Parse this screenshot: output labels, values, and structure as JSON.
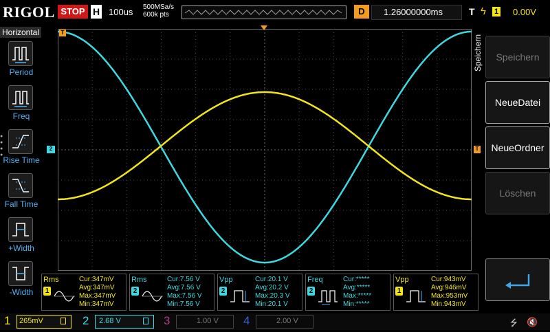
{
  "topbar": {
    "logo": "RIGOL",
    "run_state": "STOP",
    "timebase_label": "H",
    "timebase": "100us",
    "sample_rate": "500MSa/s",
    "memory_depth": "600k pts",
    "delay_label": "D",
    "delay": "1.26000000ms",
    "trigger_label": "T",
    "trigger_source": "1",
    "trigger_level": "0.00V"
  },
  "left_menu": {
    "title": "Horizontal",
    "items": [
      {
        "label": "Period",
        "icon": "period-icon"
      },
      {
        "label": "Freq",
        "icon": "frequency-icon"
      },
      {
        "label": "Rise Time",
        "icon": "rise-time-icon"
      },
      {
        "label": "Fall Time",
        "icon": "fall-time-icon"
      },
      {
        "label": "+Width",
        "icon": "positive-width-icon"
      },
      {
        "label": "-Width",
        "icon": "negative-width-icon"
      }
    ]
  },
  "right_menu": {
    "title": "Speichern",
    "buttons": [
      {
        "label": "Speichern",
        "enabled": false
      },
      {
        "label": "NeueDatei",
        "enabled": true
      },
      {
        "label": "NeueOrdner",
        "enabled": true
      },
      {
        "label": "Löschen",
        "enabled": false
      }
    ],
    "enter_icon": "enter-arrow-icon"
  },
  "screen_markers": {
    "trigger_position": "T",
    "ch2_ground": "2",
    "trigger_level_marker": "T"
  },
  "waveforms": [
    {
      "channel": "2",
      "color": "#3fd8e0",
      "shape": "sine",
      "cycles_visible": 1.0,
      "phase": "peak-at-edges"
    },
    {
      "channel": "1",
      "color": "#f2e61a",
      "shape": "sine",
      "cycles_visible": 1.0,
      "phase": "peak-at-center"
    }
  ],
  "measurements": [
    {
      "name": "Rms",
      "channel": "1",
      "color": "#f2e61a",
      "icon": "rms-sine-icon",
      "cur": "Cur:347mV",
      "avg": "Avg:347mV",
      "max": "Max:347mV",
      "min": "Min:347mV"
    },
    {
      "name": "Rms",
      "channel": "2",
      "color": "#3fd8e0",
      "icon": "rms-sine-icon",
      "cur": "Cur:7.56 V",
      "avg": "Avg:7.56 V",
      "max": "Max:7.56 V",
      "min": "Min:7.56 V"
    },
    {
      "name": "Vpp",
      "channel": "2",
      "color": "#3fd8e0",
      "icon": "vpp-pulse-icon",
      "cur": "Cur:20.1 V",
      "avg": "Avg:20.2 V",
      "max": "Max:20.3 V",
      "min": "Min:20.1 V"
    },
    {
      "name": "Freq",
      "channel": "2",
      "color": "#3fd8e0",
      "icon": "frequency-pulse-icon",
      "cur": "Cur:*****",
      "avg": "Avg:*****",
      "max": "Max:*****",
      "min": "Min:*****"
    },
    {
      "name": "Vpp",
      "channel": "1",
      "color": "#f2e61a",
      "icon": "vpp-pulse-icon",
      "cur": "Cur:943mV",
      "avg": "Avg:946mV",
      "max": "Max:953mV",
      "min": "Min:943mV"
    }
  ],
  "channels": [
    {
      "number": "1",
      "scale": "265mV",
      "color": "#f2e61a",
      "active": true
    },
    {
      "number": "2",
      "scale": "2.68 V",
      "color": "#3fd8e0",
      "active": true
    },
    {
      "number": "3",
      "scale": "1.00 V",
      "color": "#b0388a",
      "active": false
    },
    {
      "number": "4",
      "scale": "2.00 V",
      "color": "#3a62c8",
      "active": false
    }
  ],
  "status": {
    "usb_icon": "usb-icon",
    "speaker_icon": "speaker-muted-icon"
  }
}
